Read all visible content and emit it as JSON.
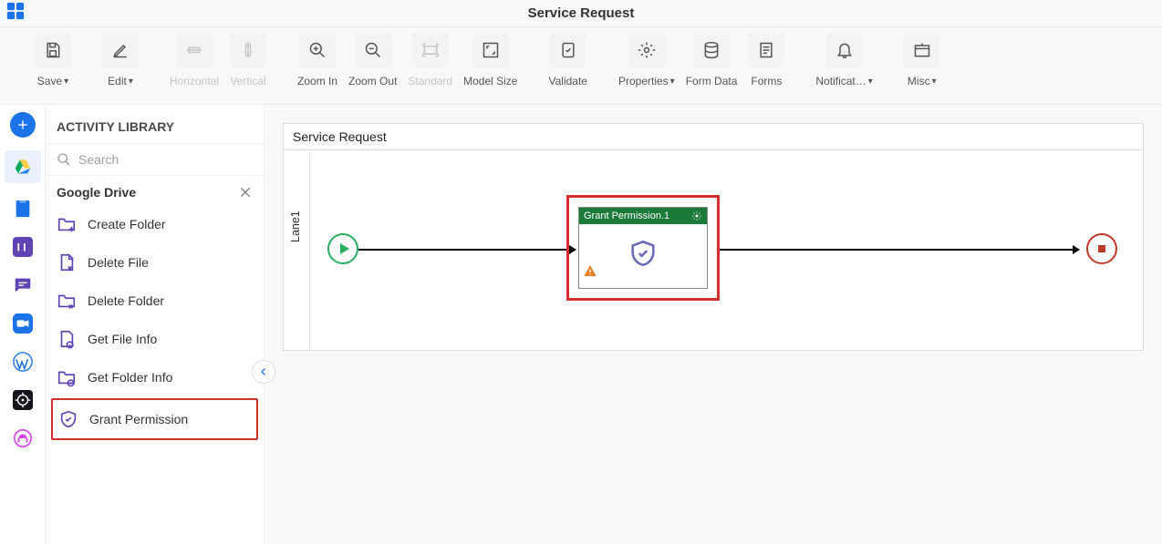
{
  "page_title": "Service Request",
  "toolbar": {
    "save": "Save",
    "edit": "Edit",
    "horizontal": "Horizontal",
    "vertical": "Vertical",
    "zoom_in": "Zoom In",
    "zoom_out": "Zoom Out",
    "standard": "Standard",
    "model_size": "Model Size",
    "validate": "Validate",
    "properties": "Properties",
    "form_data": "Form Data",
    "forms": "Forms",
    "notifications": "Notificat…",
    "misc": "Misc"
  },
  "sidebar": {
    "title": "ACTIVITY LIBRARY",
    "search_placeholder": "Search",
    "section": "Google Drive",
    "items": {
      "0": {
        "label": "Create Folder"
      },
      "1": {
        "label": "Delete File"
      },
      "2": {
        "label": "Delete Folder"
      },
      "3": {
        "label": "Get File Info"
      },
      "4": {
        "label": "Get Folder Info"
      },
      "5": {
        "label": "Grant Permission"
      }
    }
  },
  "canvas": {
    "pool_title": "Service Request",
    "lane_label": "Lane1",
    "activity_title": "Grant Permission.1"
  }
}
